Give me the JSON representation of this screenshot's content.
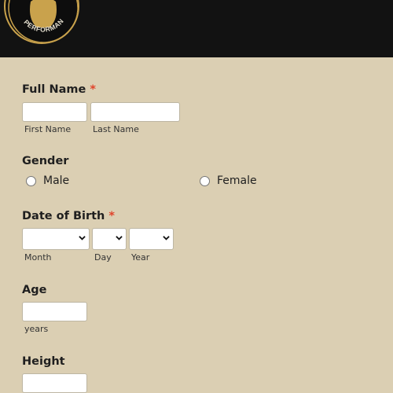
{
  "header": {
    "logo_text": "PERFORMANCE"
  },
  "form": {
    "full_name": {
      "label": "Full Name",
      "required_mark": "*",
      "first_name_sublabel": "First Name",
      "last_name_sublabel": "Last Name",
      "first_name_value": "",
      "last_name_value": ""
    },
    "gender": {
      "label": "Gender",
      "options": [
        "Male",
        "Female"
      ]
    },
    "date_of_birth": {
      "label": "Date of Birth",
      "required_mark": "*",
      "month_sublabel": "Month",
      "day_sublabel": "Day",
      "year_sublabel": "Year"
    },
    "age": {
      "label": "Age",
      "sublabel": "years",
      "value": ""
    },
    "height": {
      "label": "Height"
    }
  },
  "colors": {
    "background": "#dbcfb3",
    "header": "#121212",
    "logo_gold": "#c9a24c",
    "required": "#e0442b"
  },
  "icons": {
    "logo": "kettlebell-icon",
    "select_caret": "chevron-down-icon"
  }
}
